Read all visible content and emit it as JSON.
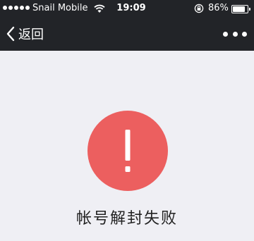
{
  "status_bar": {
    "signal_dots": 5,
    "carrier": "Snail Mobile",
    "time": "19:09",
    "battery_percent_text": "86%",
    "battery_level": 0.86,
    "icons": [
      "signal-dots-icon",
      "wifi-icon",
      "orientation-lock-icon",
      "battery-icon"
    ]
  },
  "nav_bar": {
    "back_label": "返回",
    "back_icon": "chevron-left-icon",
    "more_icon": "more-dots-icon"
  },
  "content": {
    "alert_icon": "exclamation-icon",
    "alert_color": "#ec5f5f",
    "message": "帐号解封失败"
  },
  "colors": {
    "header_bg": "#222428",
    "page_bg": "#efeff4"
  }
}
